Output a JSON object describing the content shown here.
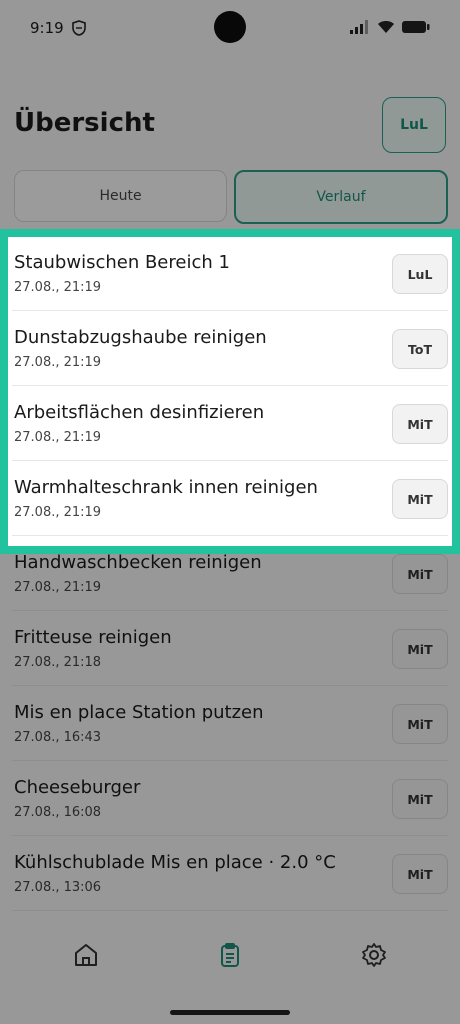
{
  "status_bar": {
    "time": "9:19"
  },
  "header": {
    "title": "Übersicht",
    "user_badge": "LuL"
  },
  "tabs": [
    {
      "label": "Heute"
    },
    {
      "label": "Verlauf"
    }
  ],
  "entries": [
    {
      "title": "Staubwischen Bereich 1",
      "time": "27.08., 21:19",
      "user": "LuL"
    },
    {
      "title": "Dunstabzugshaube reinigen",
      "time": "27.08., 21:19",
      "user": "ToT"
    },
    {
      "title": "Arbeitsflächen desinfizieren",
      "time": "27.08., 21:19",
      "user": "MiT"
    },
    {
      "title": "Warmhalteschrank innen reinigen",
      "time": "27.08., 21:19",
      "user": "MiT"
    },
    {
      "title": "Handwaschbecken reinigen",
      "time": "27.08., 21:19",
      "user": "MiT"
    },
    {
      "title": "Fritteuse reinigen",
      "time": "27.08., 21:18",
      "user": "MiT"
    },
    {
      "title": "Mis en place Station putzen",
      "time": "27.08., 16:43",
      "user": "MiT"
    },
    {
      "title": "Cheeseburger",
      "time": "27.08., 16:08",
      "user": "MiT"
    },
    {
      "title": "Kühlschublade Mis en place · 2.0 °C",
      "time": "27.08., 13:06",
      "user": "MiT"
    }
  ],
  "bottom_nav": [
    {
      "icon": "home-icon",
      "active": false
    },
    {
      "icon": "clipboard-icon",
      "active": true
    },
    {
      "icon": "gear-icon",
      "active": false
    }
  ],
  "colors": {
    "accent": "#2b9d86",
    "highlight_border": "#23c29f"
  }
}
